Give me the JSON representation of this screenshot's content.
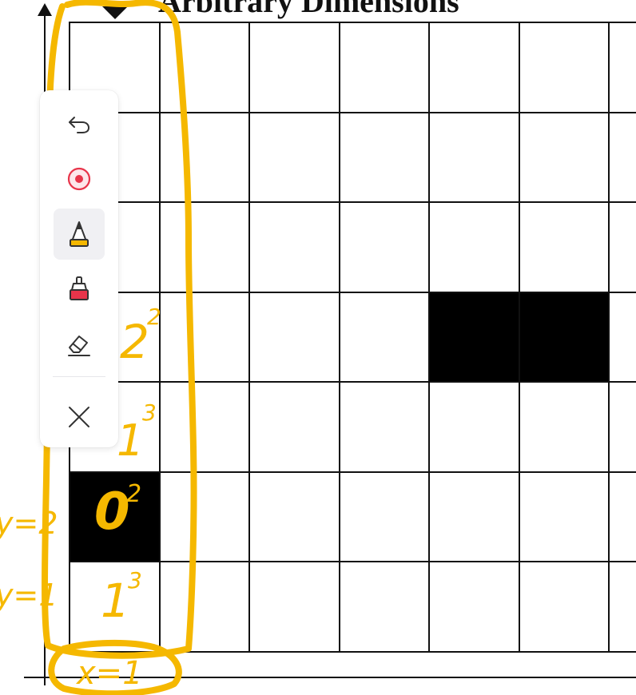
{
  "header": {
    "title": "Arbitrary Dimensions"
  },
  "grid": {
    "rows": 7,
    "cols": 7,
    "filled_cells": [
      [
        3,
        4
      ],
      [
        3,
        5
      ],
      [
        5,
        0
      ]
    ]
  },
  "annotations": {
    "labels": [
      "2",
      "2",
      "1",
      "3",
      "0",
      "2",
      "1",
      "3",
      "y=2",
      "y=1",
      "x=1"
    ],
    "ink_color": "#f5b800"
  },
  "toolbar": {
    "tools": [
      {
        "name": "undo",
        "icon": "undo-icon",
        "active": false
      },
      {
        "name": "laser",
        "icon": "laser-pointer-icon",
        "active": false
      },
      {
        "name": "pen",
        "icon": "pen-icon",
        "active": true
      },
      {
        "name": "highlighter",
        "icon": "highlighter-icon",
        "active": false
      },
      {
        "name": "eraser",
        "icon": "eraser-icon",
        "active": false
      },
      {
        "name": "close",
        "icon": "close-icon",
        "active": false
      }
    ],
    "colors": {
      "pen": "#f5b800",
      "laser": "#e8344a",
      "highlighter": "#e8344a",
      "icon": "#333333"
    }
  }
}
